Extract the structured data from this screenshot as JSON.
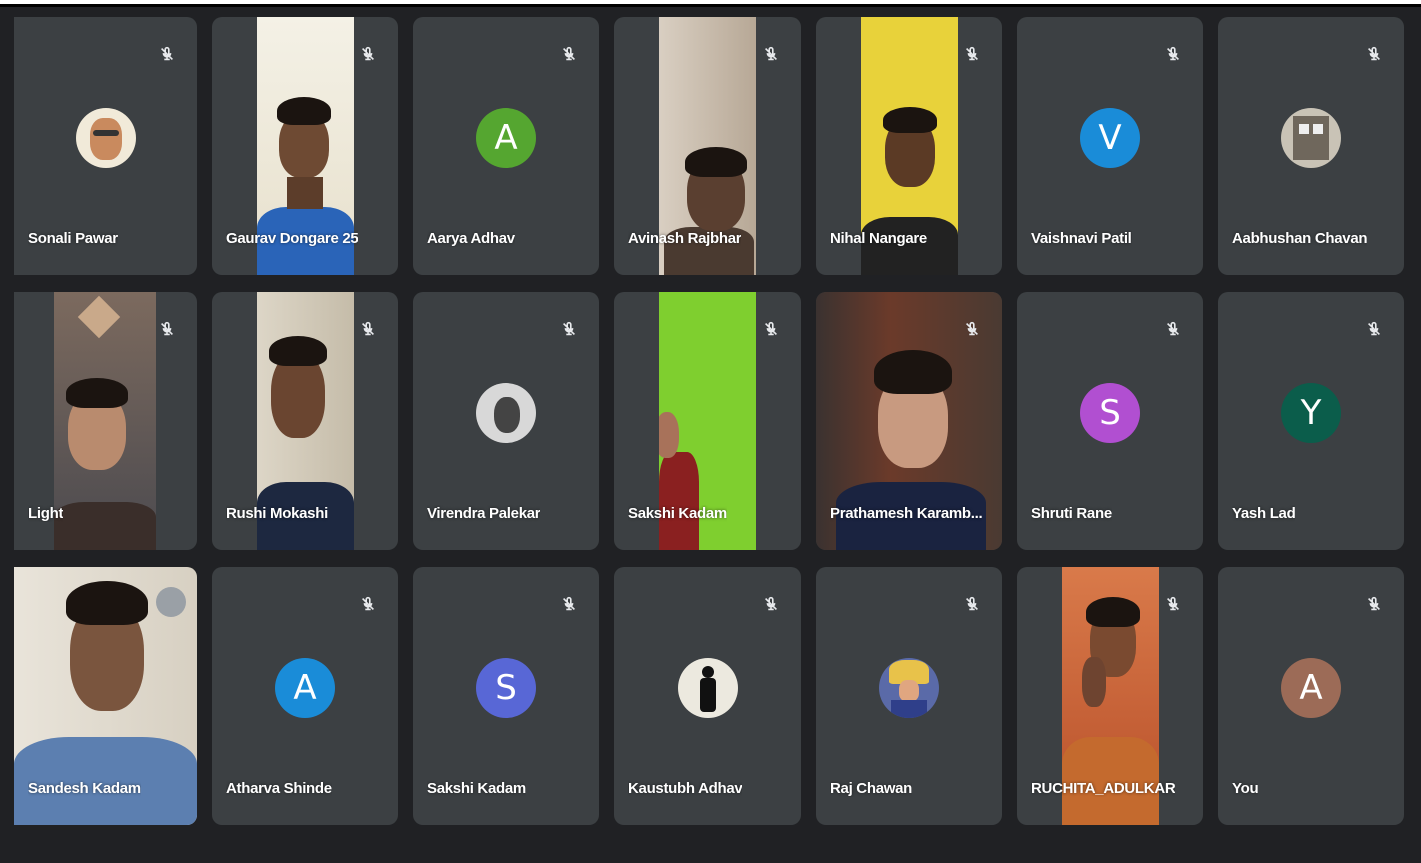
{
  "participants": [
    {
      "name": "Sonali Pawar",
      "type": "photo",
      "color": "#c98a5e"
    },
    {
      "name": "Gaurav Dongare 25",
      "type": "video"
    },
    {
      "name": "Aarya Adhav",
      "type": "letter",
      "initial": "A",
      "color": "#55a630"
    },
    {
      "name": "Avinash Rajbhar",
      "type": "video"
    },
    {
      "name": "Nihal Nangare",
      "type": "video"
    },
    {
      "name": "Vaishnavi Patil",
      "type": "letter",
      "initial": "V",
      "color": "#1a8cd8"
    },
    {
      "name": "Aabhushan Chavan",
      "type": "photo",
      "color": "#8a8276"
    },
    {
      "name": "Light",
      "type": "video"
    },
    {
      "name": "Rushi Mokashi",
      "type": "video"
    },
    {
      "name": "Virendra Palekar",
      "type": "photo",
      "color": "#9a9a9a"
    },
    {
      "name": "Sakshi Kadam",
      "type": "video"
    },
    {
      "name": "Prathamesh Karamb...",
      "type": "video"
    },
    {
      "name": "Shruti Rane",
      "type": "letter",
      "initial": "S",
      "color": "#b14fd1"
    },
    {
      "name": "Yash Lad",
      "type": "letter",
      "initial": "Y",
      "color": "#0b5d4b"
    },
    {
      "name": "Sandesh Kadam",
      "type": "video"
    },
    {
      "name": "Atharva Shinde",
      "type": "letter",
      "initial": "A",
      "color": "#1a8cd8"
    },
    {
      "name": "Sakshi Kadam",
      "type": "letter",
      "initial": "S",
      "color": "#5867d6"
    },
    {
      "name": "Kaustubh Adhav",
      "type": "photo",
      "color": "#ece9df"
    },
    {
      "name": "Raj Chawan",
      "type": "photo",
      "color": "#5a6aa8"
    },
    {
      "name": "RUCHITA_ADULKAR",
      "type": "video"
    },
    {
      "name": "You",
      "type": "letter",
      "initial": "A",
      "color": "#9c6b57"
    }
  ],
  "icons": {
    "muted": "mic-off-icon"
  }
}
